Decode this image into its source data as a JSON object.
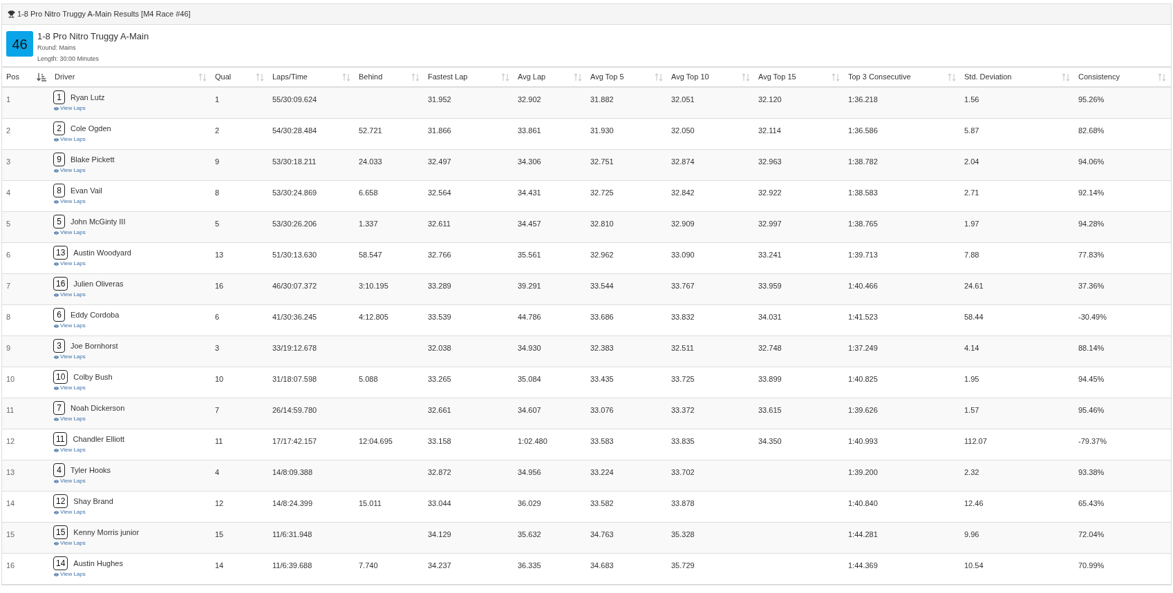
{
  "panel": {
    "title": "1-8 Pro Nitro Truggy A-Main Results [M4 Race #46]"
  },
  "race": {
    "number": "46",
    "name": "1-8 Pro Nitro Truggy A-Main",
    "round": "Round: Mains",
    "length": "Length: 30:00 Minutes"
  },
  "table": {
    "columns": [
      {
        "label": "Pos",
        "sorted": true
      },
      {
        "label": "Driver",
        "sorted": false
      },
      {
        "label": "Qual",
        "sorted": false
      },
      {
        "label": "Laps/Time",
        "sorted": false
      },
      {
        "label": "Behind",
        "sorted": false
      },
      {
        "label": "Fastest Lap",
        "sorted": false
      },
      {
        "label": "Avg Lap",
        "sorted": false
      },
      {
        "label": "Avg Top 5",
        "sorted": false
      },
      {
        "label": "Avg Top 10",
        "sorted": false
      },
      {
        "label": "Avg Top 15",
        "sorted": false
      },
      {
        "label": "Top 3 Consecutive",
        "sorted": false
      },
      {
        "label": "Std. Deviation",
        "sorted": false
      },
      {
        "label": "Consistency",
        "sorted": false
      }
    ],
    "rows": [
      {
        "cells": [
          "1",
          {
            "number": "1",
            "name": "Ryan Lutz",
            "link": "View Laps"
          },
          "1",
          "55/30:09.624",
          "",
          "31.952",
          "32.902",
          "31.882",
          "32.051",
          "32.120",
          "1:36.218",
          "1.56",
          "95.26%"
        ]
      },
      {
        "cells": [
          "2",
          {
            "number": "2",
            "name": "Cole Ogden",
            "link": "View Laps"
          },
          "2",
          "54/30:28.484",
          "52.721",
          "31.866",
          "33.861",
          "31.930",
          "32.050",
          "32.114",
          "1:36.586",
          "5.87",
          "82.68%"
        ]
      },
      {
        "cells": [
          "3",
          {
            "number": "9",
            "name": "Blake Pickett",
            "link": "View Laps"
          },
          "9",
          "53/30:18.211",
          "24.033",
          "32.497",
          "34.306",
          "32.751",
          "32.874",
          "32.963",
          "1:38.782",
          "2.04",
          "94.06%"
        ]
      },
      {
        "cells": [
          "4",
          {
            "number": "8",
            "name": "Evan Vail",
            "link": "View Laps"
          },
          "8",
          "53/30:24.869",
          "6.658",
          "32.564",
          "34.431",
          "32.725",
          "32.842",
          "32.922",
          "1:38.583",
          "2.71",
          "92.14%"
        ]
      },
      {
        "cells": [
          "5",
          {
            "number": "5",
            "name": "John McGinty III",
            "link": "View Laps"
          },
          "5",
          "53/30:26.206",
          "1.337",
          "32.611",
          "34.457",
          "32.810",
          "32.909",
          "32.997",
          "1:38.765",
          "1.97",
          "94.28%"
        ]
      },
      {
        "cells": [
          "6",
          {
            "number": "13",
            "name": "Austin Woodyard",
            "link": "View Laps"
          },
          "13",
          "51/30:13.630",
          "58.547",
          "32.766",
          "35.561",
          "32.962",
          "33.090",
          "33.241",
          "1:39.713",
          "7.88",
          "77.83%"
        ]
      },
      {
        "cells": [
          "7",
          {
            "number": "16",
            "name": "Julien Oliveras",
            "link": "View Laps"
          },
          "16",
          "46/30:07.372",
          "3:10.195",
          "33.289",
          "39.291",
          "33.544",
          "33.767",
          "33.959",
          "1:40.466",
          "24.61",
          "37.36%"
        ]
      },
      {
        "cells": [
          "8",
          {
            "number": "6",
            "name": "Eddy Cordoba",
            "link": "View Laps"
          },
          "6",
          "41/30:36.245",
          "4:12.805",
          "33.539",
          "44.786",
          "33.686",
          "33.832",
          "34.031",
          "1:41.523",
          "58.44",
          "-30.49%"
        ]
      },
      {
        "cells": [
          "9",
          {
            "number": "3",
            "name": "Joe Bornhorst",
            "link": "View Laps"
          },
          "3",
          "33/19:12.678",
          "",
          "32.038",
          "34.930",
          "32.383",
          "32.511",
          "32.748",
          "1:37.249",
          "4.14",
          "88.14%"
        ]
      },
      {
        "cells": [
          "10",
          {
            "number": "10",
            "name": "Colby Bush",
            "link": "View Laps"
          },
          "10",
          "31/18:07.598",
          "5.088",
          "33.265",
          "35.084",
          "33.435",
          "33.725",
          "33.899",
          "1:40.825",
          "1.95",
          "94.45%"
        ]
      },
      {
        "cells": [
          "11",
          {
            "number": "7",
            "name": "Noah Dickerson",
            "link": "View Laps"
          },
          "7",
          "26/14:59.780",
          "",
          "32.661",
          "34.607",
          "33.076",
          "33.372",
          "33.615",
          "1:39.626",
          "1.57",
          "95.46%"
        ]
      },
      {
        "cells": [
          "12",
          {
            "number": "11",
            "name": "Chandler Elliott",
            "link": "View Laps"
          },
          "11",
          "17/17:42.157",
          "12:04.695",
          "33.158",
          "1:02.480",
          "33.583",
          "33.835",
          "34.350",
          "1:40.993",
          "112.07",
          "-79.37%"
        ]
      },
      {
        "cells": [
          "13",
          {
            "number": "4",
            "name": "Tyler Hooks",
            "link": "View Laps"
          },
          "4",
          "14/8:09.388",
          "",
          "32.872",
          "34.956",
          "33.224",
          "33.702",
          "",
          "1:39.200",
          "2.32",
          "93.38%"
        ]
      },
      {
        "cells": [
          "14",
          {
            "number": "12",
            "name": "Shay Brand",
            "link": "View Laps"
          },
          "12",
          "14/8:24.399",
          "15.011",
          "33.044",
          "36.029",
          "33.582",
          "33.878",
          "",
          "1:40.840",
          "12.46",
          "65.43%"
        ]
      },
      {
        "cells": [
          "15",
          {
            "number": "15",
            "name": "Kenny Morris junior",
            "link": "View Laps"
          },
          "15",
          "11/6:31.948",
          "",
          "34.129",
          "35.632",
          "34.763",
          "35.328",
          "",
          "1:44.281",
          "9.96",
          "72.04%"
        ]
      },
      {
        "cells": [
          "16",
          {
            "number": "14",
            "name": "Austin Hughes",
            "link": "View Laps"
          },
          "14",
          "11/6:39.688",
          "7.740",
          "34.237",
          "36.335",
          "34.683",
          "35.729",
          "",
          "1:44.369",
          "10.54",
          "70.99%"
        ]
      }
    ]
  }
}
